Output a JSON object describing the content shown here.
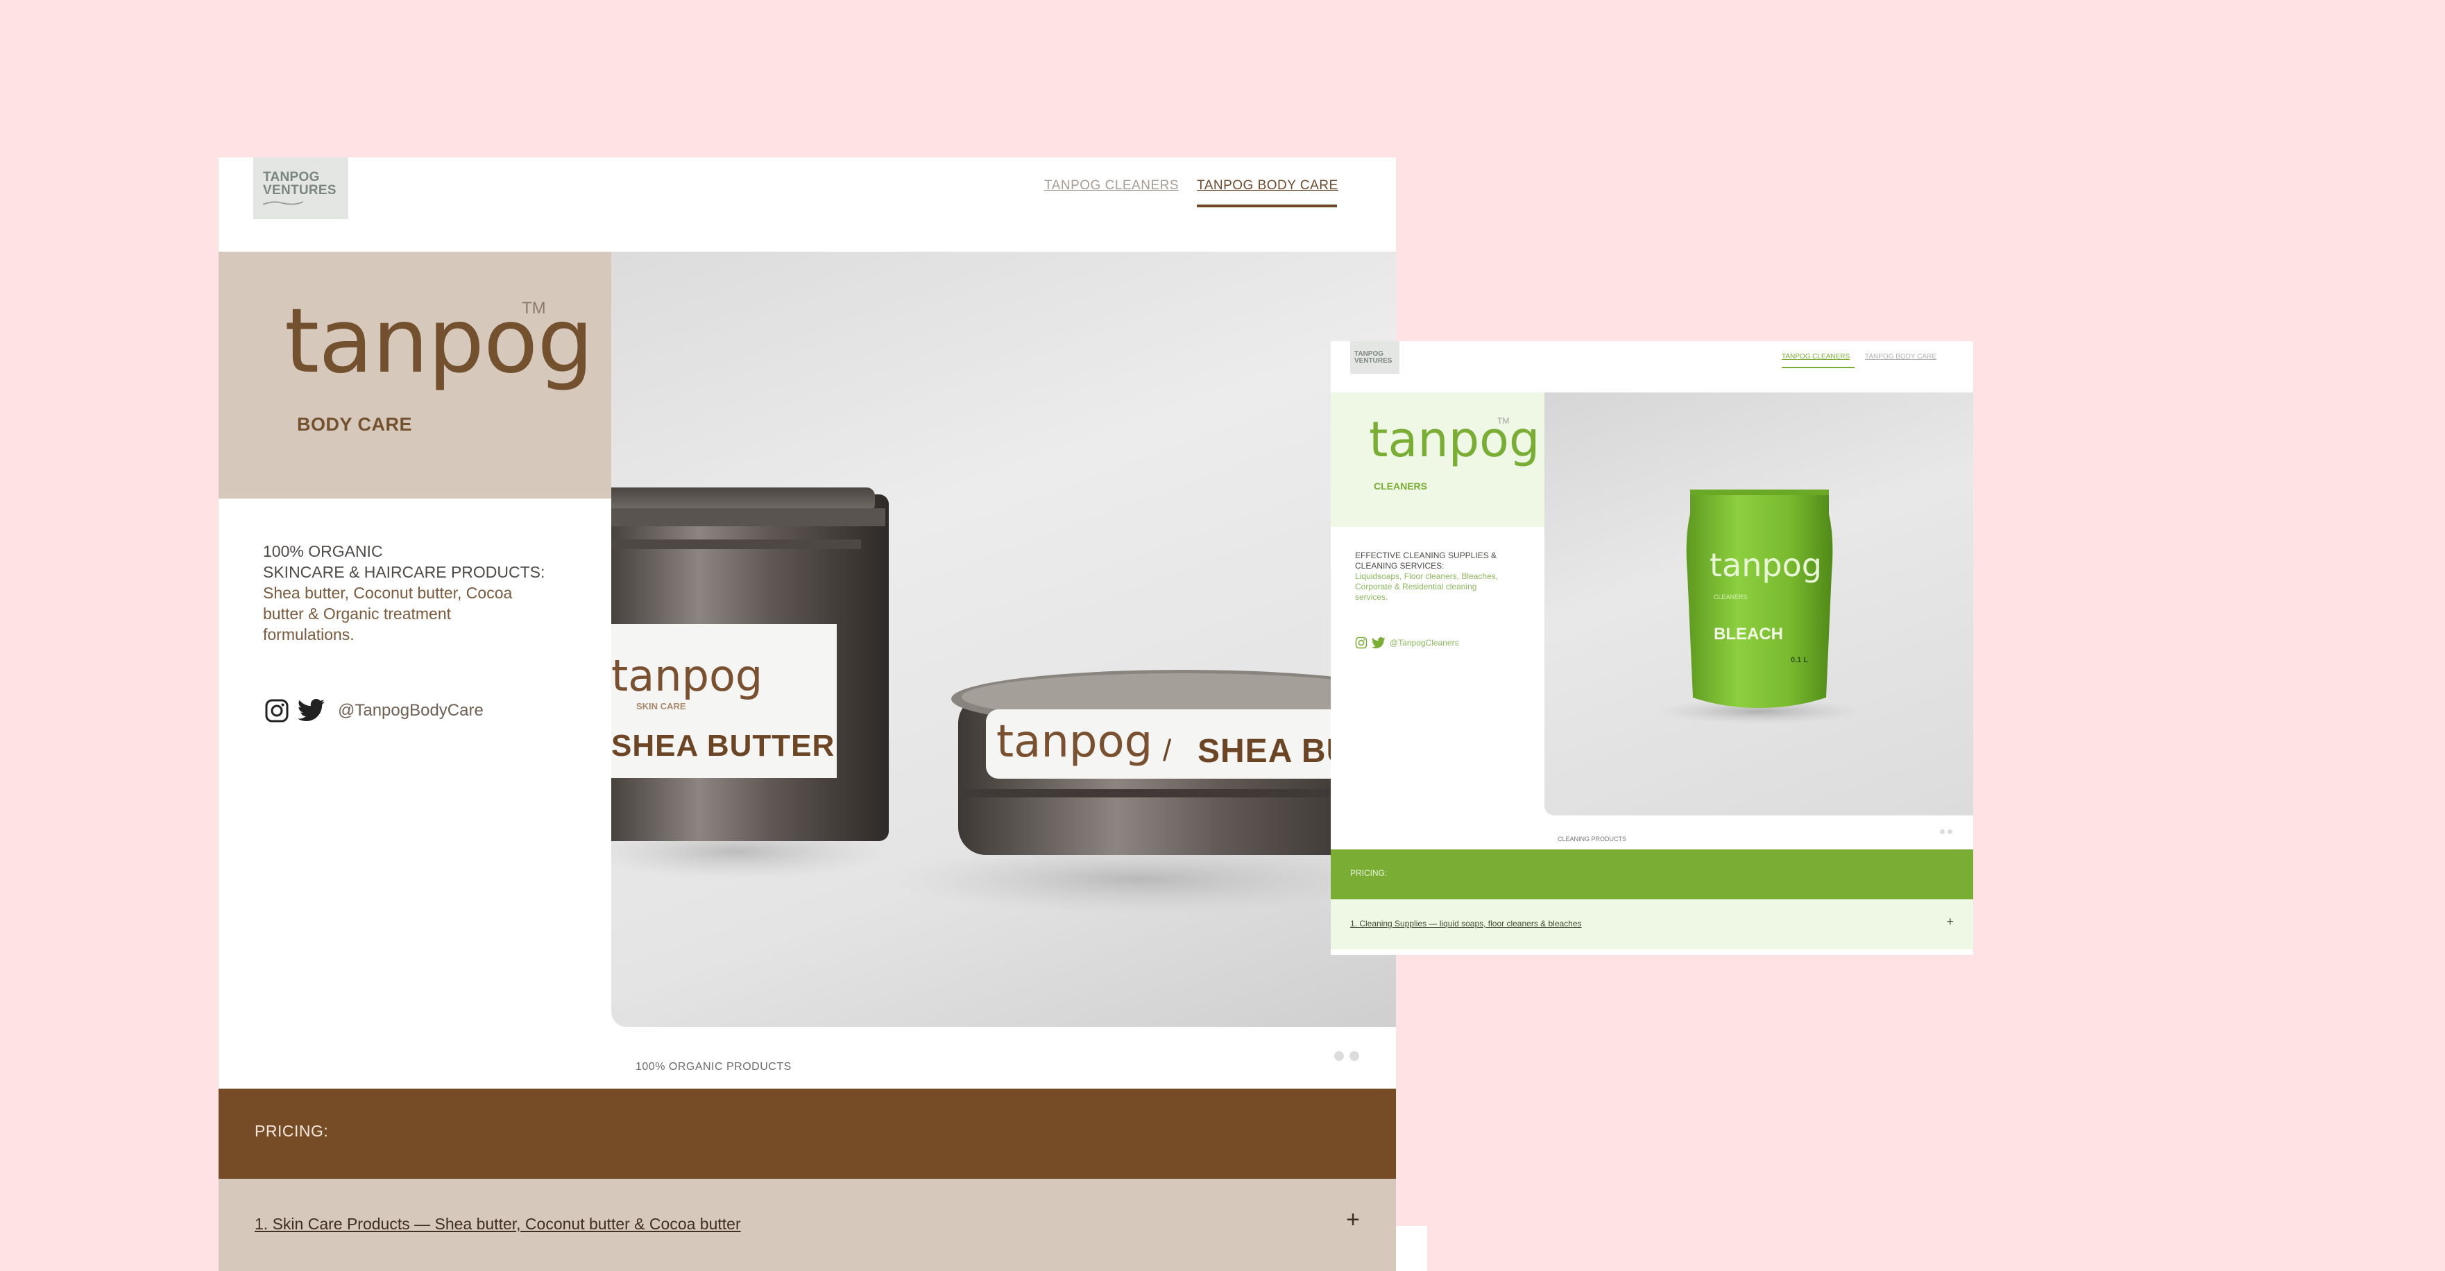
{
  "main": {
    "logo": {
      "line1": "TANPOG",
      "line2": "VENTURES"
    },
    "nav": {
      "cleaners": "TANPOG CLEANERS",
      "body_care": "TANPOG BODY CARE"
    },
    "brand": {
      "word": "tanpog",
      "tm": "TM",
      "sub": "BODY CARE"
    },
    "desc": {
      "line1": "100% ORGANIC",
      "line2": "SKINCARE & HAIRCARE PRODUCTS:",
      "list": [
        "Shea butter, Coconut butter, Cocoa",
        "butter & Organic treatment",
        "formulations."
      ]
    },
    "social": {
      "handle": "@TanpogBodyCare"
    },
    "hero": {
      "tin1_brand": "tanpog",
      "tin1_sub": "SKIN CARE",
      "tin1_product": "SHEA BUTTER",
      "tin2_brand": "tanpog",
      "tin2_sep": "/",
      "tin2_product": "SHEA BUTTER"
    },
    "caption": "100% ORGANIC PRODUCTS",
    "pricing": "PRICING:",
    "accordion": {
      "item1": "1. Skin Care Products — Shea butter, Coconut butter & Cocoa butter",
      "plus": "+"
    }
  },
  "small": {
    "logo": {
      "line1": "TANPOG",
      "line2": "VENTURES"
    },
    "nav": {
      "cleaners": "TANPOG CLEANERS",
      "body_care": "TANPOG BODY CARE"
    },
    "brand": {
      "word": "tanpog",
      "tm": "TM",
      "sub": "CLEANERS"
    },
    "desc": {
      "line1": "EFFECTIVE CLEANING SUPPLIES &",
      "line2": "CLEANING SERVICES:",
      "list": [
        "Liquidsoaps, Floor cleaners, Bleaches,",
        "Corporate & Residential cleaning",
        "services."
      ]
    },
    "social": {
      "handle": "@TanpogCleaners"
    },
    "hero": {
      "pouch_brand": "tanpog",
      "pouch_sub": "CLEANERS",
      "pouch_product": "BLEACH",
      "pouch_size": "0.1 L"
    },
    "caption": "CLEANING PRODUCTS",
    "pricing": "PRICING:",
    "accordion": {
      "item1": "1. Cleaning Supplies — liquid soaps, floor cleaners & bleaches",
      "plus": "+"
    }
  },
  "colors": {
    "background": "#fee2e4",
    "body_care_brown": "#754c25",
    "body_care_beige": "#d6c9bc",
    "cleaners_green": "#79ad34",
    "cleaners_light": "#eff7e5"
  }
}
